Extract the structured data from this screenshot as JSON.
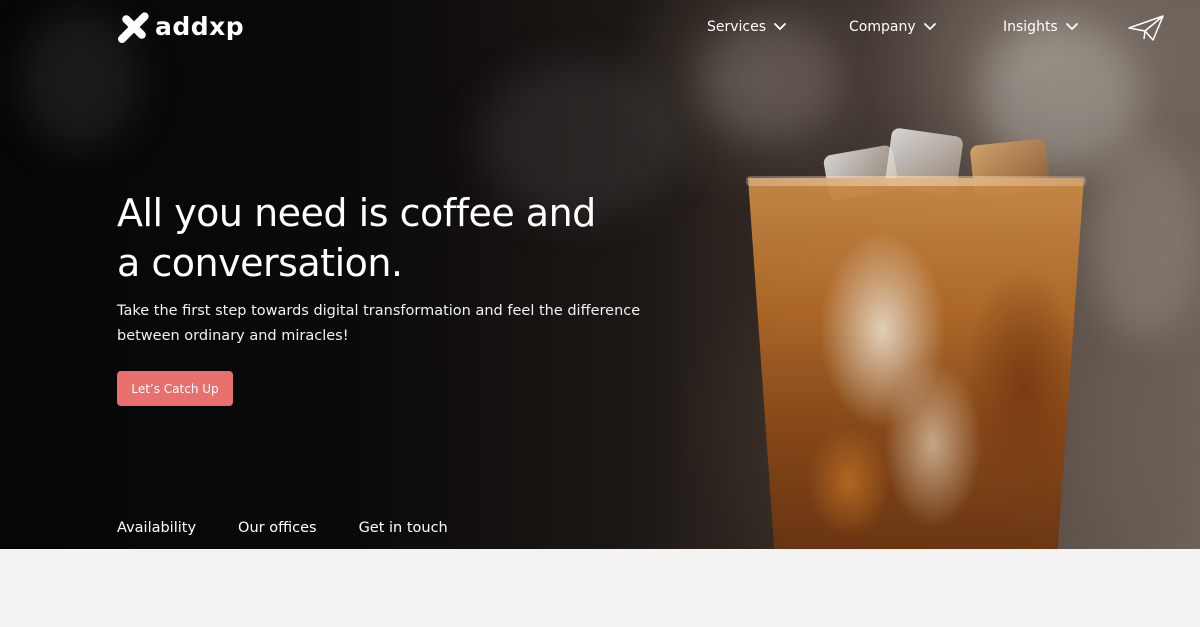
{
  "brand": {
    "name": "addxp",
    "logo_color": "#ffffff"
  },
  "nav": {
    "items": [
      {
        "label": "Services"
      },
      {
        "label": "Company"
      },
      {
        "label": "Insights"
      }
    ],
    "contact_icon": "paper-plane-icon",
    "dropdown_icon": "chevron-down-icon"
  },
  "hero": {
    "headline_line1": "All you need is coffee and",
    "headline_line2": "a conversation.",
    "subtext_line1": "Take the first step towards digital transformation and feel the difference",
    "subtext_line2": "between ordinary and miracles!",
    "cta_label": "Let’s Catch Up",
    "cta_color": "#e8716f"
  },
  "bottom_links": [
    {
      "label": "Availability"
    },
    {
      "label": "Our offices"
    },
    {
      "label": "Get in touch"
    }
  ]
}
